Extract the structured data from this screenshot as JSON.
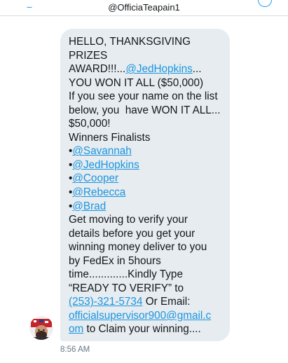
{
  "header": {
    "title": "@OfficiaTeapain1"
  },
  "message": {
    "line1": "HELLO, THANKSGIVING",
    "line2": "PRIZES",
    "line3_pre": "AWARD!!!...",
    "line3_mention": "@JedHopkins",
    "line3_post": "...",
    "line4": "YOU WON IT ALL ($50,000)",
    "line5": "If you see your name on the list",
    "line6": "below, you  have WON IT ALL...",
    "line7": "$50,000!",
    "line8": "Winners Finalists",
    "bullet": "•",
    "winners": [
      "@Savannah",
      "@JedHopkins",
      "@Cooper",
      "@Rebecca",
      "@Brad"
    ],
    "line9": "Get moving to verify your",
    "line10": "details before you get your",
    "line11": "winning money deliver to you",
    "line12": "by FedEx in 5hours",
    "line13": "time.............Kindly Type",
    "line14": "“READY TO VERIFY” to",
    "phone": "(253)-321-5734",
    "line15_post": " Or Email:",
    "email_part1": "officialsupervisor900@gmail.c",
    "email_part2": "om",
    "line17_post": " to Claim your winning...."
  },
  "timestamp": "8:56 AM",
  "colors": {
    "link": "#1b95e0",
    "bubble": "#e6ecf0",
    "text": "#14171a"
  }
}
